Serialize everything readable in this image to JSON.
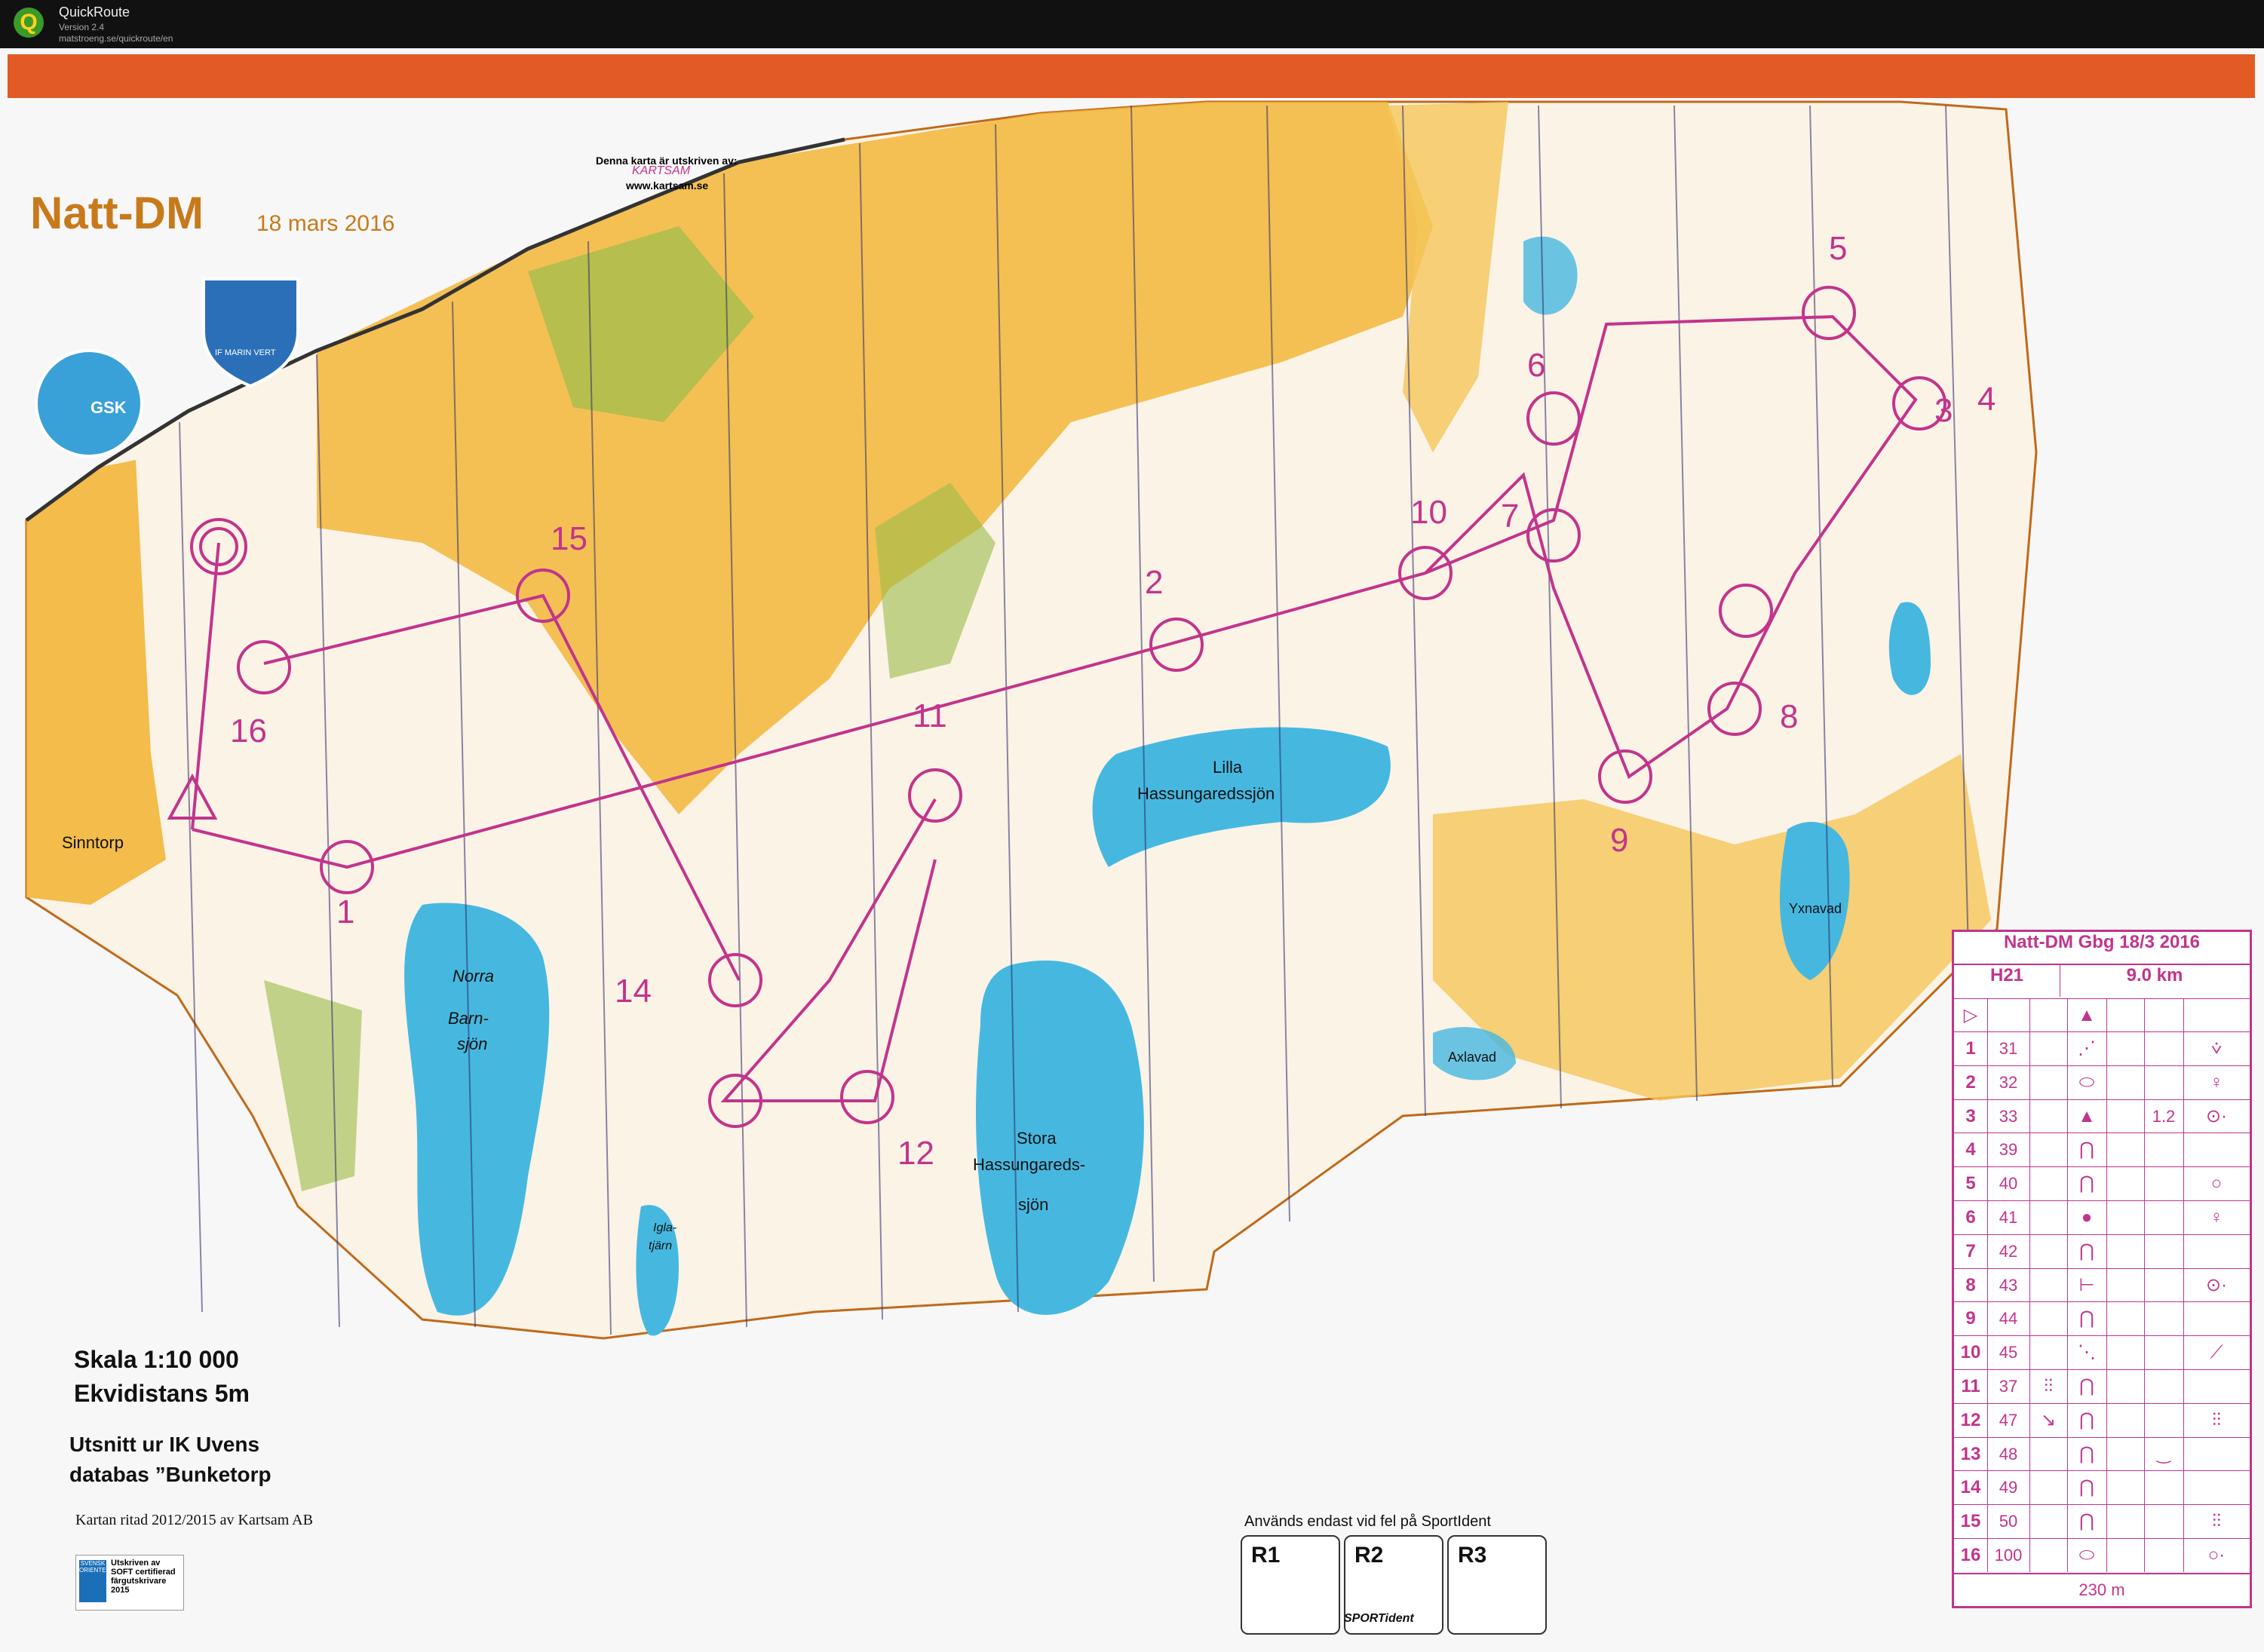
{
  "app": {
    "name": "QuickRoute",
    "version": "Version 2.4",
    "url": "matstroeng.se/quickroute/en"
  },
  "map": {
    "title": "Natt-DM",
    "date": "18 mars 2016",
    "printed_by": "Denna karta är utskriven av:",
    "printed_by_logo": "KARTSAM",
    "printed_url": "www.kartsam.se",
    "club_badge_left": "GSK",
    "club_badge_right": "IF MARIN VERT",
    "scale": "Skala 1:10 000",
    "contour": "Ekvidistans 5m",
    "excerpt_line1": "Utsnitt ur IK Uvens",
    "excerpt_line2": "databas ”Bunketorp",
    "drawn_by": "Kartan ritad 2012/2015 av Kartsam AB",
    "soft_badge": {
      "icon": "SVENSK ORIENTERING",
      "line1": "Utskriven av",
      "line2": "SOFT certifierad",
      "line3": "färgutskrivare",
      "line4": "2015"
    },
    "place_names": {
      "sinntorp": "Sinntorp",
      "norra": "Norra",
      "barnsjon1": "Barn-",
      "barnsjon2": "sjön",
      "lilla": "Lilla",
      "lilla_lake": "Hassungaredssjön",
      "stora": "Stora",
      "stora2": "Hassungareds-",
      "stora3": "sjön",
      "yxnavad": "Yxnavad",
      "axlavad": "Axlavad",
      "igla1": "Igla-",
      "igla2": "tjärn"
    },
    "controls": [
      "1",
      "2",
      "3",
      "4",
      "5",
      "6",
      "7",
      "8",
      "9",
      "10",
      "11",
      "12",
      "14",
      "15",
      "16"
    ],
    "sportident_note": "Används endast vid fel på SportIdent",
    "rboxes": [
      "R1",
      "R2",
      "R3"
    ],
    "sportident_logo": "SPORTident"
  },
  "descriptions": {
    "title": "Natt-DM Gbg 18/3 2016",
    "class": "H21",
    "length": "9.0 km",
    "start_icon": "start-triangle-icon",
    "rows": [
      {
        "n": "1",
        "code": "31",
        "c": "⋰",
        "g": "",
        "d": "",
        "x": "",
        "s": "⩒"
      },
      {
        "n": "2",
        "code": "32",
        "c": "⬭",
        "g": "",
        "d": "",
        "x": "",
        "s": "♀"
      },
      {
        "n": "3",
        "code": "33",
        "c": "▲",
        "g": "",
        "d": "1.2",
        "x": "",
        "s": "⊙·"
      },
      {
        "n": "4",
        "code": "39",
        "c": "⋂",
        "g": "",
        "d": "",
        "x": "",
        "s": ""
      },
      {
        "n": "5",
        "code": "40",
        "c": "⋂",
        "g": "",
        "d": "",
        "x": "",
        "s": "○"
      },
      {
        "n": "6",
        "code": "41",
        "c": "●",
        "g": "",
        "d": "",
        "x": "",
        "s": "♀"
      },
      {
        "n": "7",
        "code": "42",
        "c": "⋂",
        "g": "",
        "d": "",
        "x": "",
        "s": ""
      },
      {
        "n": "8",
        "code": "43",
        "c": "⊢",
        "g": "",
        "d": "",
        "x": "",
        "s": "⊙·"
      },
      {
        "n": "9",
        "code": "44",
        "c": "⋂",
        "g": "",
        "d": "",
        "x": "",
        "s": ""
      },
      {
        "n": "10",
        "code": "45",
        "c": "⋱",
        "g": "",
        "d": "",
        "x": "",
        "s": "⟋"
      },
      {
        "n": "11",
        "code": "37",
        "g": "⫶⫶",
        "c": "⋂",
        "d": "",
        "x": "",
        "s": ""
      },
      {
        "n": "12",
        "code": "47",
        "g": "↘",
        "c": "⋂",
        "d": "",
        "x": "",
        "s": "⫶⫶"
      },
      {
        "n": "13",
        "code": "48",
        "c": "⋂",
        "g": "",
        "d": "‿",
        "x": "",
        "s": ""
      },
      {
        "n": "14",
        "code": "49",
        "c": "⋂",
        "g": "",
        "d": "",
        "x": "",
        "s": ""
      },
      {
        "n": "15",
        "code": "50",
        "c": "⋂",
        "g": "",
        "d": "",
        "x": "",
        "s": "⫶⫶"
      },
      {
        "n": "16",
        "code": "100",
        "c": "⬭",
        "g": "",
        "d": "",
        "x": "",
        "s": "○·"
      }
    ],
    "footer": "230 m"
  }
}
